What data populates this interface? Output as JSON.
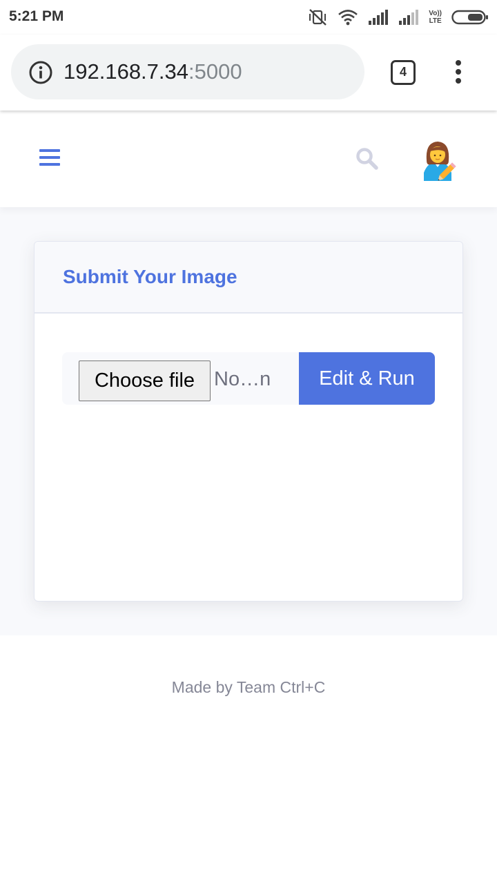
{
  "status_bar": {
    "time": "5:21 PM",
    "icons": [
      "vibrate-off-icon",
      "wifi-icon",
      "signal-icon",
      "signal-icon",
      "volte-icon",
      "battery-icon"
    ],
    "volte_top": "Vo))",
    "volte_bottom": "LTE"
  },
  "browser": {
    "url_host": "192.168.7.34",
    "url_port": ":5000",
    "tab_count": "4",
    "icons": [
      "info-icon",
      "more-vert-icon"
    ]
  },
  "navbar": {
    "icons": [
      "hamburger-menu-icon",
      "search-icon",
      "avatar-icon"
    ]
  },
  "card": {
    "title": "Submit Your Image",
    "choose_file_label": "Choose file",
    "file_name": "No…n",
    "submit_label": "Edit & Run"
  },
  "footer": {
    "text": "Made by Team Ctrl+C"
  },
  "colors": {
    "accent": "#4e73df",
    "page_bg": "#f8f9fc",
    "muted_text": "#858796"
  }
}
